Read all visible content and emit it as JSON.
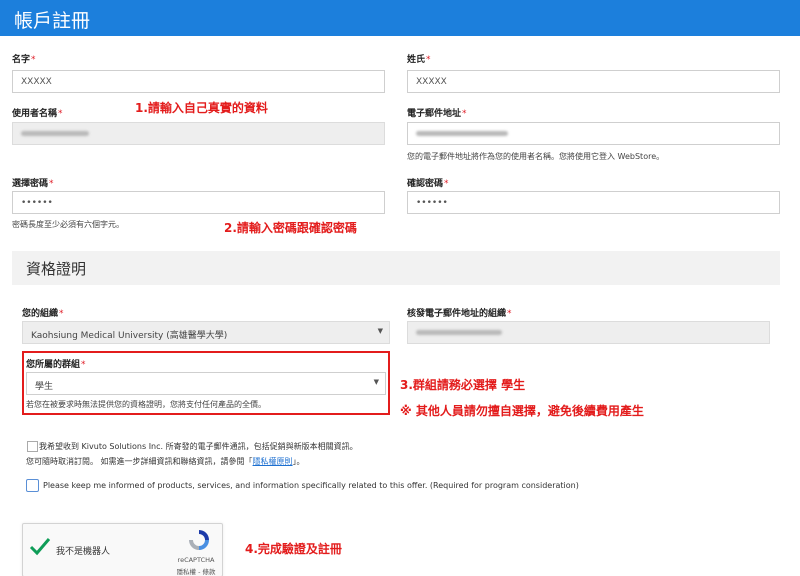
{
  "header": {
    "title": "帳戶註冊"
  },
  "form": {
    "first_name": {
      "label": "名字",
      "value": "XXXXX"
    },
    "last_name": {
      "label": "姓氏",
      "value": "XXXXX"
    },
    "username": {
      "label": "使用者名稱"
    },
    "email": {
      "label": "電子郵件地址",
      "hint": "您的電子郵件地址將作為您的使用者名稱。您將使用它登入 WebStore。"
    },
    "password": {
      "label": "選擇密碼",
      "value": "••••••",
      "hint": "密碼長度至少必須有六個字元。"
    },
    "confirm_password": {
      "label": "確認密碼",
      "value": "••••••"
    },
    "required_mark": "*"
  },
  "section": {
    "title": "資格證明"
  },
  "eligibility": {
    "org": {
      "label": "您的組織",
      "value": "Kaohsiung Medical University (高雄醫學大學)"
    },
    "email_org": {
      "label": "核發電子郵件地址的組織"
    },
    "group": {
      "label": "您所屬的群組",
      "value": "學生",
      "hint": "若您在被要求時無法提供您的資格證明，您將支付任何產品的全價。"
    }
  },
  "consent": {
    "line1": "我希望收到 Kivuto Solutions Inc. 所寄發的電子郵件通訊，包括促銷與新版本相關資訊。",
    "line2_prefix": "您可隨時取消訂閱。 如需進一步詳細資訊和聯絡資訊，請參閱「",
    "line2_link": "隱私權原則",
    "line2_suffix": "」。",
    "english": "Please keep me informed of products, services, and information specifically related to this offer. (Required for program consideration)"
  },
  "recaptcha": {
    "label": "我不是機器人",
    "brand": "reCAPTCHA",
    "links": "隱私權 - 條款"
  },
  "annotations": {
    "a1": "1.請輸入自己真實的資料",
    "a2": "2.請輸入密碼跟確認密碼",
    "a3": "3.群組請務必選擇  學生",
    "a3b": "※ 其他人員請勿擅自選擇，避免後續費用產生",
    "a4": "4.完成驗證及註冊"
  },
  "icons": {
    "caret": "caret-down-icon",
    "check": "checkmark-icon",
    "recaptcha_logo": "recaptcha-logo-icon"
  },
  "colors": {
    "header": "#1c7fdc",
    "annotation": "#e31c1c",
    "link": "#1c6fd0",
    "check": "#0f9d58"
  }
}
